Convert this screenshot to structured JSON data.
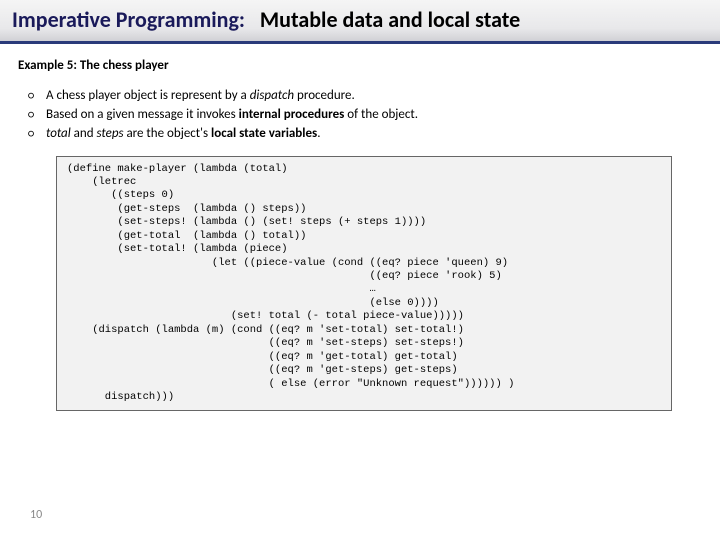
{
  "header": {
    "title_prefix": "Imperative Programming:",
    "title_rest": "Mutable data and local state"
  },
  "example": {
    "label": "Example 5: The chess player"
  },
  "bullets": [
    {
      "html": "A chess player object is represent by a <i>dispatch</i> procedure."
    },
    {
      "html": "Based on a given message it invokes <b>internal procedures</b> of the object."
    },
    {
      "html": "<i>total</i> and <i>steps</i> are the object's <b>local state variables</b>."
    }
  ],
  "code": "(define make-player (lambda (total)\n    (letrec\n       ((steps 0)\n        (get-steps  (lambda () steps))\n        (set-steps! (lambda () (set! steps (+ steps 1))))\n        (get-total  (lambda () total))\n        (set-total! (lambda (piece)\n                       (let ((piece-value (cond ((eq? piece 'queen) 9)\n                                                ((eq? piece 'rook) 5)\n                                                …\n                                                (else 0))))\n                          (set! total (- total piece-value)))))\n    (dispatch (lambda (m) (cond ((eq? m 'set-total) set-total!)\n                                ((eq? m 'set-steps) set-steps!)\n                                ((eq? m 'get-total) get-total)\n                                ((eq? m 'get-steps) get-steps)\n                                ( else (error \"Unknown request\")))))) )\n      dispatch)))",
  "page_number": "10"
}
